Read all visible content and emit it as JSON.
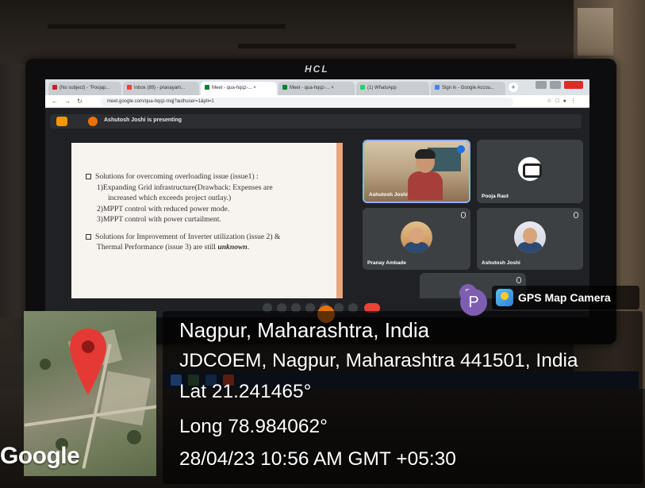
{
  "monitor": {
    "brand": "HCL"
  },
  "browser": {
    "tabs": [
      {
        "label": "(No subject) - \"Poojap...",
        "fav_color": "#c5221f"
      },
      {
        "label": "Inbox (89) - pranayam...",
        "fav_color": "#ea4335"
      },
      {
        "label": "Meet - qua-hqqz-... ×",
        "fav_color": "#00832d"
      },
      {
        "label": "Meet - qua-hqqz-... ×",
        "fav_color": "#00832d"
      },
      {
        "label": "(1) WhatsApp",
        "fav_color": "#25d366"
      },
      {
        "label": "Sign in - Google Accou...",
        "fav_color": "#4285f4"
      }
    ],
    "url": "meet.google.com/qua-hqqz-mqj?authuser=1&pli=1"
  },
  "meet": {
    "presenting_banner": "Ashutosh Joshi is presenting",
    "slide": {
      "bullet1": "Solutions for overcoming overloading issue (issue1) :",
      "line1a": "1)Expanding Grid infrastructure(Drawback: Expenses are",
      "line1b": "increased which exceeds project outlay.)",
      "line2": "2)MPPT control with reduced power mode.",
      "line3": "3)MPPT control with power curtailment.",
      "bullet2a": "Solutions for Improvement of Inverter utilization (issue 2) &",
      "bullet2b_prefix": "Thermal Performance (issue 3) are still ",
      "bullet2b_em": "unknown",
      "bullet2b_suffix": "."
    },
    "participants": [
      {
        "name": "Ashutosh Joshi"
      },
      {
        "name": "Pooja Raut"
      },
      {
        "name": "Pranay Ambade"
      },
      {
        "name": "Ashutosh Joshi"
      },
      {
        "name": "P"
      }
    ]
  },
  "overlay": {
    "avatar_letter": "P",
    "app_name": "GPS Map Camera",
    "location_title": "Nagpur, Maharashtra, India",
    "address": "JDCOEM, Nagpur, Maharashtra 441501, India",
    "latitude": "Lat 21.241465°",
    "longitude": "Long 78.984062°",
    "timestamp": "28/04/23 10:56 AM GMT +05:30",
    "map_logo": "Google"
  },
  "colors": {
    "meet_background": "#202124",
    "tile_background": "#3c4043",
    "active_speaker_border": "#8ab4f8",
    "map_pin": "#e53935",
    "gps_overlay": "rgba(0,0,0,0.58)"
  }
}
